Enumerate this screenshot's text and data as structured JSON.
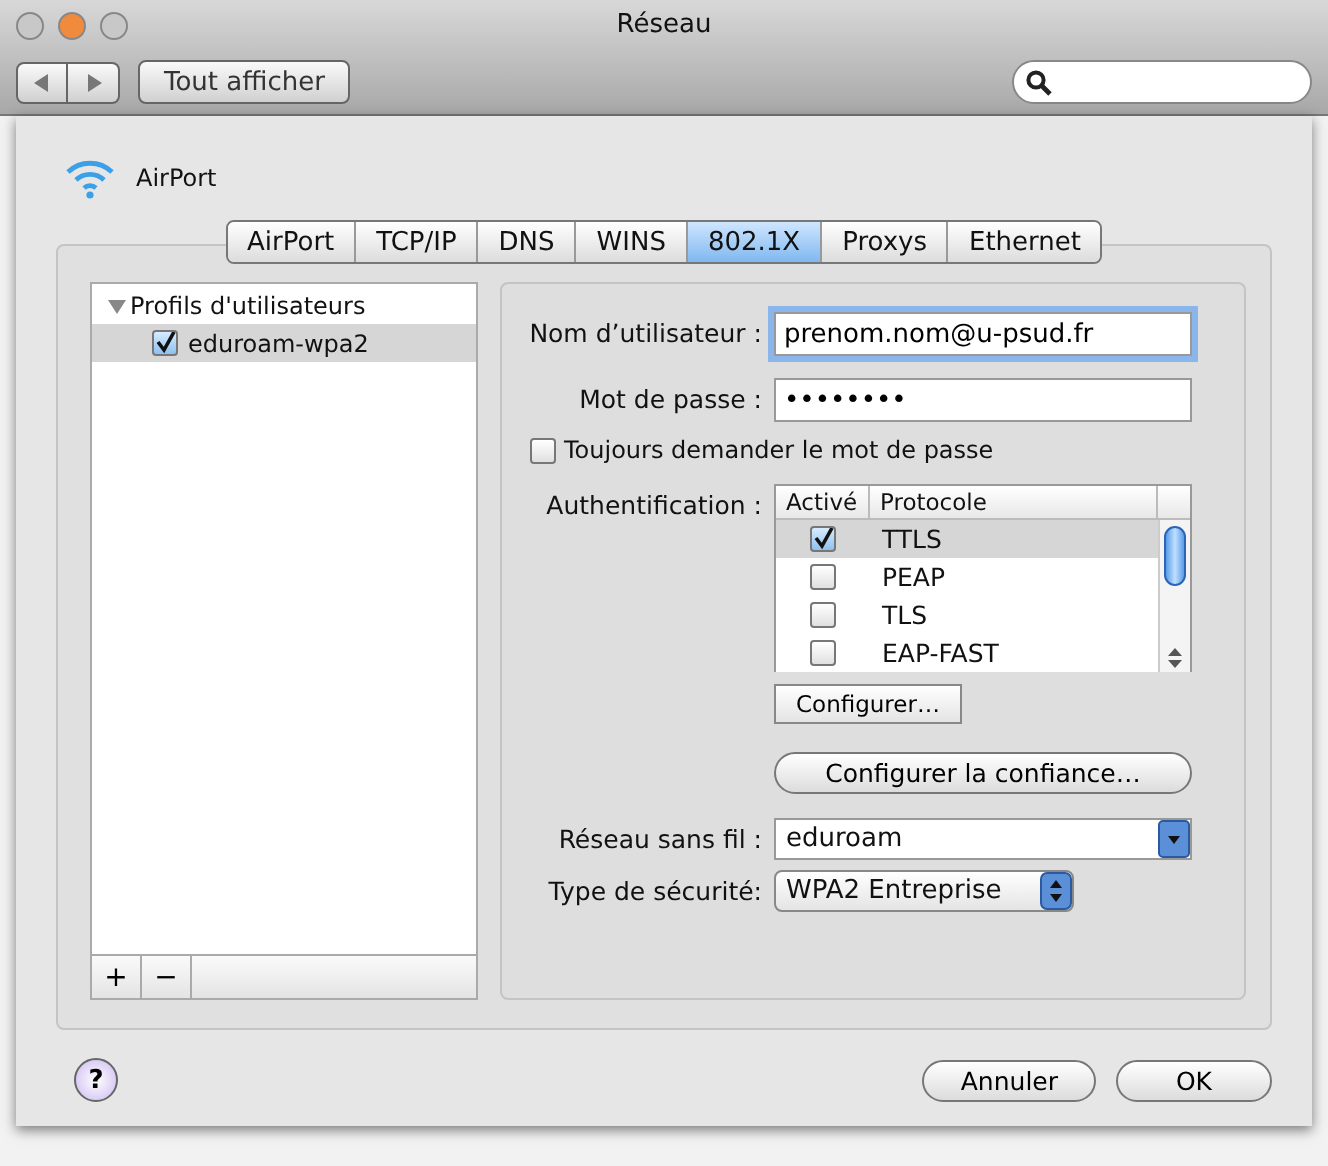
{
  "window": {
    "title": "Réseau"
  },
  "toolbar": {
    "show_all": "Tout afficher"
  },
  "service": {
    "name": "AirPort"
  },
  "tabs": [
    {
      "label": "AirPort",
      "selected": false
    },
    {
      "label": "TCP/IP",
      "selected": false
    },
    {
      "label": "DNS",
      "selected": false
    },
    {
      "label": "WINS",
      "selected": false
    },
    {
      "label": "802.1X",
      "selected": true
    },
    {
      "label": "Proxys",
      "selected": false
    },
    {
      "label": "Ethernet",
      "selected": false
    }
  ],
  "profiles": {
    "label": "Profils d'utilisateurs",
    "expanded": true,
    "children": [
      {
        "label": "eduroam-wpa2",
        "checked": true,
        "selected": true
      }
    ],
    "add": "+",
    "remove": "−"
  },
  "form": {
    "username": {
      "label": "Nom d’utilisateur :",
      "value": "prenom.nom@u-psud.fr"
    },
    "password": {
      "label": "Mot de passe :",
      "value": "••••••••"
    },
    "always_ask": {
      "label": "Toujours demander le mot de passe",
      "checked": false
    },
    "authentication": {
      "label": "Authentification :",
      "columns": [
        "Activé",
        "Protocole"
      ],
      "rows": [
        {
          "protocol": "TTLS",
          "checked": true,
          "selected": true
        },
        {
          "protocol": "PEAP",
          "checked": false,
          "selected": false
        },
        {
          "protocol": "TLS",
          "checked": false,
          "selected": false
        },
        {
          "protocol": "EAP-FAST",
          "checked": false,
          "selected": false
        }
      ]
    },
    "configure": "Configurer…",
    "trust": "Configurer la confiance…",
    "wireless": {
      "label": "Réseau sans fil :",
      "value": "eduroam"
    },
    "security": {
      "label": "Type de sécurité:",
      "value": "WPA2 Entreprise"
    }
  },
  "buttons": {
    "help": "?",
    "cancel": "Annuler",
    "ok": "OK"
  }
}
